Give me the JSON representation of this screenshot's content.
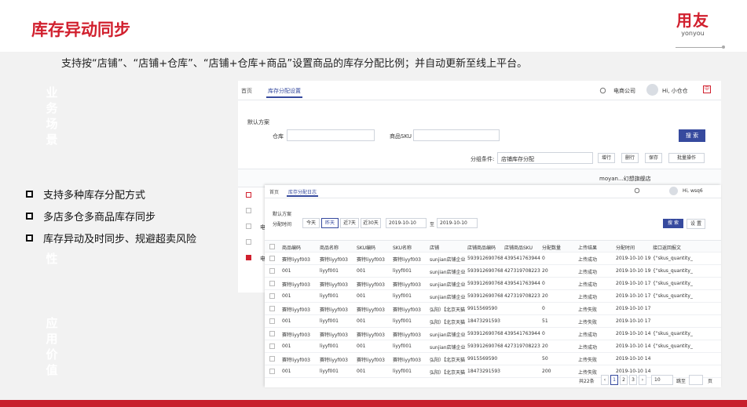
{
  "slide": {
    "title": "库存异动同步",
    "logo_cn": "用友",
    "logo_en": "yonyou",
    "subtitle": "支持按“店铺”、“店铺+仓库”、“店铺+仓库+商品”设置商品的库存分配比例；并自动更新至线上平台。",
    "watermark_top": [
      "业",
      "务",
      "场",
      "景"
    ],
    "watermark_mid": "性",
    "watermark_bottom": [
      "应",
      "用",
      "价",
      "值"
    ],
    "bullets": [
      "支持多种库存分配方式",
      "多店多仓多商品库存同步",
      "库存异动及时同步、规避超卖风险"
    ]
  },
  "settings_screen": {
    "tab_home": "首页",
    "tab_active": "库存分配设置",
    "company": "电商公司",
    "greeting": "Hi, 小仓仓",
    "filter_label": "默认方案",
    "warehouse_label": "仓库",
    "sku_label": "商品SKU",
    "search_btn": "搜 索",
    "cond_label": "分组条件:",
    "cond_value": "店铺库存分配",
    "add_btn": "增行",
    "del_btn": "删行",
    "save_btn": "保存",
    "batch_btn": "批量操作",
    "store_header": "moyan...幻想旗舰店",
    "row_prefix": "电"
  },
  "log_screen": {
    "tab_home": "首页",
    "tab_active": "库存分配日志",
    "greeting": "Hi, wsq6",
    "filter_label": "默认方案",
    "time_label": "分配时间",
    "time_options": [
      "今天",
      "昨天",
      "近7天",
      "近30天"
    ],
    "date_from": "2019-10-10",
    "date_sep": "至",
    "date_to": "2019-10-10",
    "search_btn": "搜 索",
    "settings_btn": "设 置",
    "columns": [
      "商品编码",
      "商品名称",
      "SKU编码",
      "SKU名称",
      "店铺",
      "店铺商品编码",
      "店铺商品SKU",
      "分配数量",
      "上传结果",
      "分配时间",
      "接口返回报文"
    ],
    "rows": [
      [
        "赛特liyyf003",
        "赛特liyyf003",
        "赛特liyyf003",
        "赛特liyyf003",
        "sunjian店铺企业",
        "593912690768",
        "4395417639445",
        "0",
        "上传成功",
        "2019-10-10 19:",
        "{\"skus_quantity_"
      ],
      [
        "001",
        "liyyf001",
        "001",
        "liyyf001",
        "sunjian店铺企业",
        "593912690768",
        "4273197082235",
        "20",
        "上传成功",
        "2019-10-10 19:",
        "{\"skus_quantity_"
      ],
      [
        "赛特liyyf003",
        "赛特liyyf003",
        "赛特liyyf003",
        "赛特liyyf003",
        "sunjian店铺企业",
        "593912690768",
        "4395417639445",
        "0",
        "上传成功",
        "2019-10-10 17:",
        "{\"skus_quantity_"
      ],
      [
        "001",
        "liyyf001",
        "001",
        "liyyf001",
        "sunjian店铺企业",
        "593912690768",
        "4273197082235",
        "20",
        "上传成功",
        "2019-10-10 17:",
        "{\"skus_quantity_"
      ],
      [
        "赛特liyyf003",
        "赛特liyyf003",
        "赛特liyyf003",
        "赛特liyyf003",
        "弘阳）【北京天猫",
        "9915569590",
        "",
        "0",
        "上传失败",
        "2019-10-10 17:5",
        ""
      ],
      [
        "001",
        "liyyf001",
        "001",
        "liyyf001",
        "弘阳）【北京天猫",
        "18473291593",
        "",
        "51",
        "上传失败",
        "2019-10-10 17:5",
        ""
      ],
      [
        "赛特liyyf003",
        "赛特liyyf003",
        "赛特liyyf003",
        "赛特liyyf003",
        "sunjian店铺企业",
        "593912690768",
        "4395417639445",
        "0",
        "上传成功",
        "2019-10-10 14:",
        "{\"skus_quantity_"
      ],
      [
        "001",
        "liyyf001",
        "001",
        "liyyf001",
        "sunjian店铺企业",
        "593912690768",
        "4273197082235",
        "20",
        "上传成功",
        "2019-10-10 14:",
        "{\"skus_quantity_"
      ],
      [
        "赛特liyyf003",
        "赛特liyyf003",
        "赛特liyyf003",
        "赛特liyyf003",
        "弘阳）【北京天猫",
        "9915569590",
        "",
        "50",
        "上传失败",
        "2019-10-10 14:",
        ""
      ],
      [
        "001",
        "liyyf001",
        "001",
        "liyyf001",
        "弘阳）【北京天猫",
        "18473291593",
        "",
        "200",
        "上传失败",
        "2019-10-10 14:",
        ""
      ]
    ],
    "total": "共22条",
    "pages": [
      "1",
      "2",
      "3"
    ],
    "page_size": "10",
    "goto_label": "跳至",
    "page_suffix": "页"
  },
  "colors": {
    "brand_red": "#d1202e",
    "primary_blue": "#364a9e",
    "tab_underline": "#364a9e"
  },
  "icons": {
    "search": "search-icon",
    "avatar": "avatar-icon",
    "calendar": "calendar-icon"
  }
}
